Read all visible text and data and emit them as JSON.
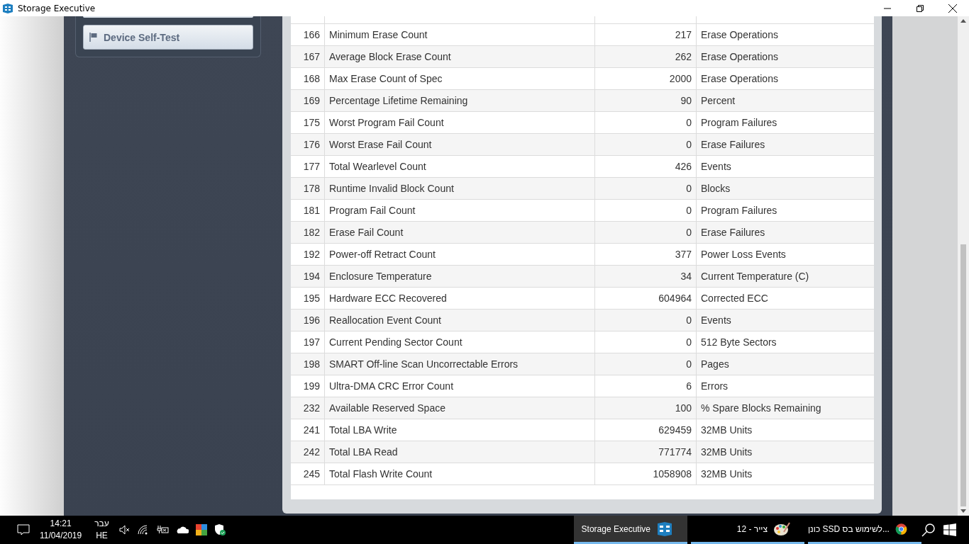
{
  "window": {
    "title": "Storage Executive"
  },
  "sidebar": {
    "button": "Device Self-Test"
  },
  "table": {
    "rows": [
      [
        "166",
        "Minimum Erase Count",
        "217",
        "Erase Operations"
      ],
      [
        "167",
        "Average Block Erase Count",
        "262",
        "Erase Operations"
      ],
      [
        "168",
        "Max Erase Count of Spec",
        "2000",
        "Erase Operations"
      ],
      [
        "169",
        "Percentage Lifetime Remaining",
        "90",
        "Percent"
      ],
      [
        "175",
        "Worst Program Fail Count",
        "0",
        "Program Failures"
      ],
      [
        "176",
        "Worst Erase Fail Count",
        "0",
        "Erase Failures"
      ],
      [
        "177",
        "Total Wearlevel Count",
        "426",
        "Events"
      ],
      [
        "178",
        "Runtime Invalid Block Count",
        "0",
        "Blocks"
      ],
      [
        "181",
        "Program Fail Count",
        "0",
        "Program Failures"
      ],
      [
        "182",
        "Erase Fail Count",
        "0",
        "Erase Failures"
      ],
      [
        "192",
        "Power-off Retract Count",
        "377",
        "Power Loss Events"
      ],
      [
        "194",
        "Enclosure Temperature",
        "34",
        "Current Temperature (C)"
      ],
      [
        "195",
        "Hardware ECC Recovered",
        "604964",
        "Corrected ECC"
      ],
      [
        "196",
        "Reallocation Event Count",
        "0",
        "Events"
      ],
      [
        "197",
        "Current Pending Sector Count",
        "0",
        "512 Byte Sectors"
      ],
      [
        "198",
        "SMART Off-line Scan Uncorrectable Errors",
        "0",
        "Pages"
      ],
      [
        "199",
        "Ultra-DMA CRC Error Count",
        "6",
        "Errors"
      ],
      [
        "232",
        "Available Reserved Space",
        "100",
        "% Spare Blocks Remaining"
      ],
      [
        "241",
        "Total LBA Write",
        "629459",
        "32MB Units"
      ],
      [
        "242",
        "Total LBA Read",
        "771774",
        "32MB Units"
      ],
      [
        "245",
        "Total Flash Write Count",
        "1058908",
        "32MB Units"
      ]
    ]
  },
  "taskbar": {
    "time": "14:21",
    "date": "11/04/2019",
    "language": "עבר",
    "language_code": "HE",
    "storage_task": {
      "label": "Storage Executive",
      "selected": true
    },
    "paint_task": {
      "label": "12 - צייר",
      "selected": false
    },
    "browser_task": {
      "label": "כונן SSD לשימוש בס...",
      "selected": false
    }
  }
}
